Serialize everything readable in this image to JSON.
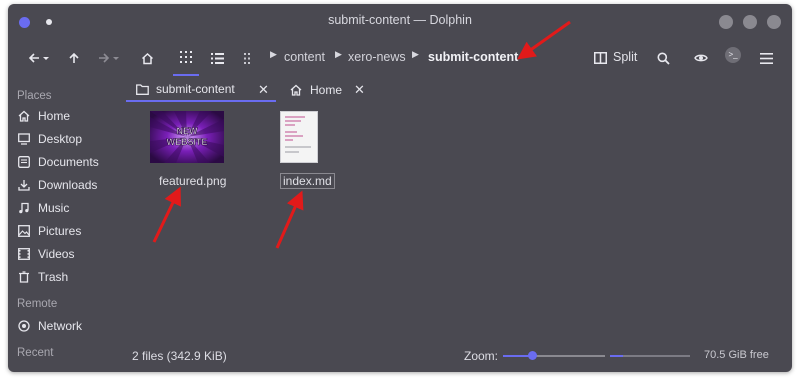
{
  "window": {
    "title": "submit-content — Dolphin"
  },
  "toolbar": {
    "breadcrumbs": [
      "content",
      "xero-news",
      "submit-content"
    ],
    "split_label": "Split",
    "terminal_glyph": ">_"
  },
  "sidebar": {
    "places_heading": "Places",
    "places": [
      {
        "label": "Home",
        "icon": "home-icon"
      },
      {
        "label": "Desktop",
        "icon": "desktop-icon"
      },
      {
        "label": "Documents",
        "icon": "documents-icon"
      },
      {
        "label": "Downloads",
        "icon": "downloads-icon"
      },
      {
        "label": "Music",
        "icon": "music-icon"
      },
      {
        "label": "Pictures",
        "icon": "pictures-icon"
      },
      {
        "label": "Videos",
        "icon": "videos-icon"
      },
      {
        "label": "Trash",
        "icon": "trash-icon"
      }
    ],
    "remote_heading": "Remote",
    "remote": [
      {
        "label": "Network",
        "icon": "network-icon"
      }
    ],
    "recent_heading": "Recent"
  },
  "tabs": [
    {
      "label": "submit-content",
      "icon": "folder-icon",
      "active": true
    },
    {
      "label": "Home",
      "icon": "home-icon",
      "active": false
    }
  ],
  "files": [
    {
      "name": "featured.png",
      "thumbnail_text": [
        "NEW",
        "WEBSITE"
      ]
    },
    {
      "name": "index.md"
    }
  ],
  "status": {
    "summary": "2 files (342.9 KiB)",
    "zoom_label": "Zoom:",
    "zoom_level": 0.28,
    "free_space_text": "70.5 GiB free",
    "used_space_fraction": 0.16
  },
  "colors": {
    "accent": "#6a6cf0",
    "window_bg": "#4a4951",
    "annotation_arrow": "#e11a1a"
  }
}
